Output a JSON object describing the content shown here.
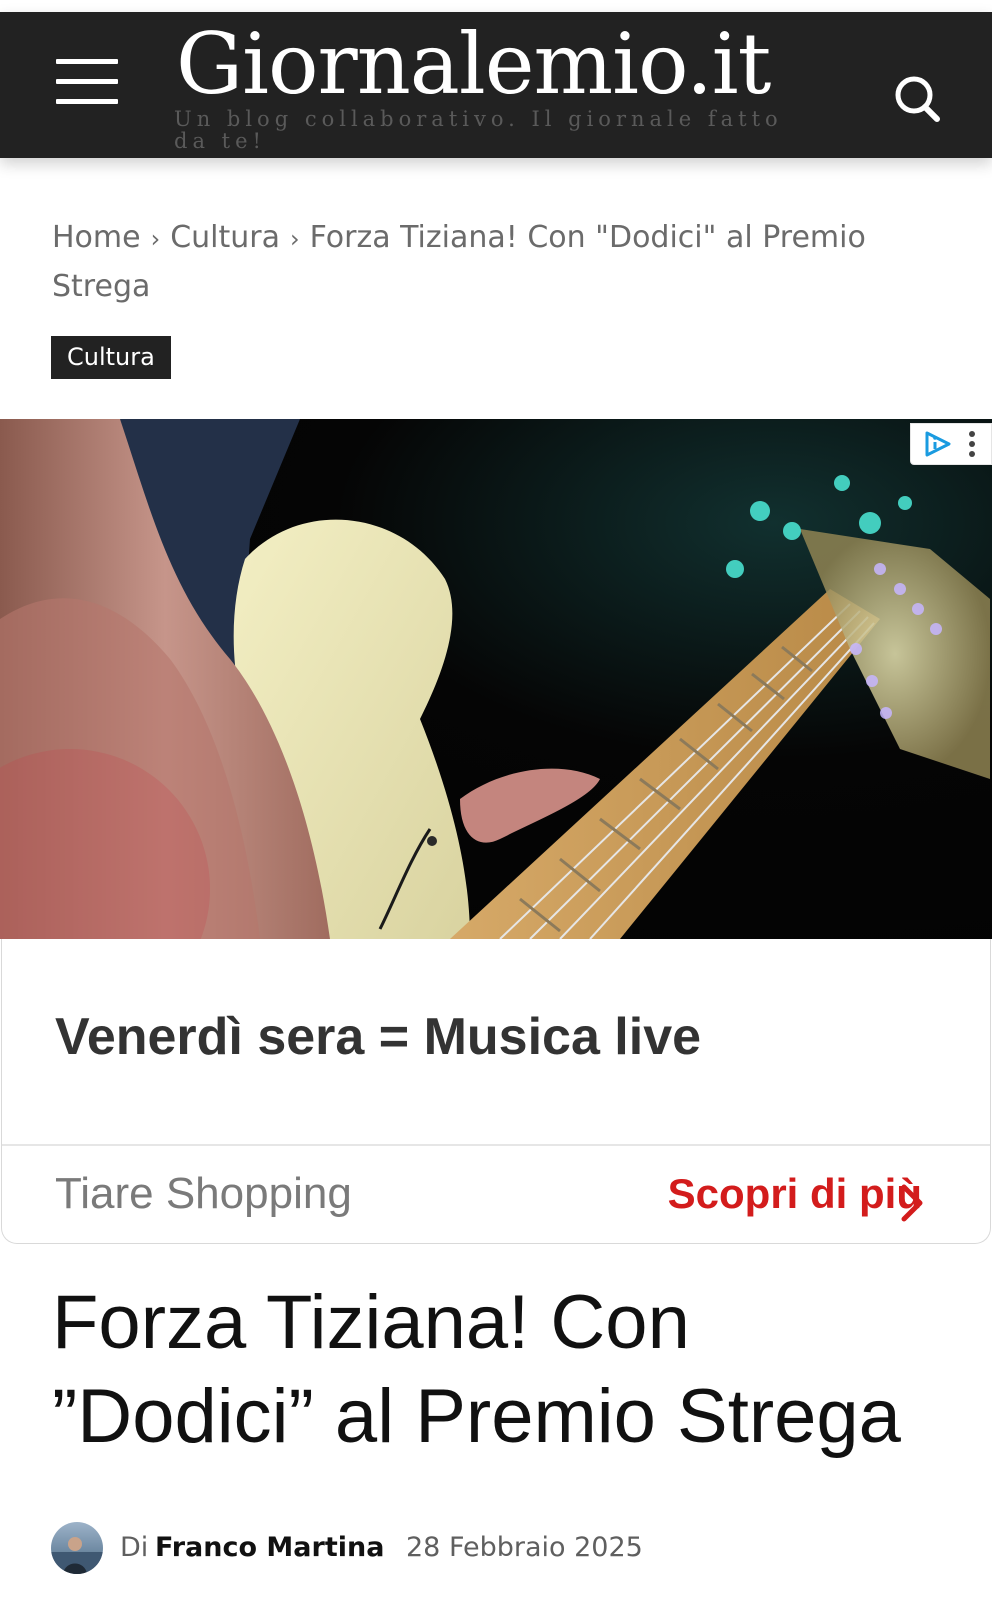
{
  "header": {
    "site_title": "Giornalemio.it",
    "tagline": "Un blog collaborativo. Il giornale fatto da te!",
    "menu_icon": "hamburger-menu-icon",
    "search_icon": "search-icon",
    "background": "#222222"
  },
  "breadcrumb": {
    "home": "Home",
    "category": "Cultura",
    "current": "Forza Tiziana! Con \"Dodici\" al Premio Strega",
    "separator": "›"
  },
  "category_badge": "Cultura",
  "ad": {
    "image": "electric-guitar-photo",
    "headline": "Venerdì sera = Musica live",
    "advertiser": "Tiare Shopping",
    "cta_label": "Scopri di più",
    "cta_color": "#d31c1c",
    "adchoices_icon": "adchoices-icon",
    "more_icon": "more-vertical-icon"
  },
  "article": {
    "title": "Forza Tiziana! Con ”Dodici” al Premio Strega",
    "byline_prefix": "Di",
    "author": "Franco Martina",
    "date": "28 Febbraio 2025"
  }
}
